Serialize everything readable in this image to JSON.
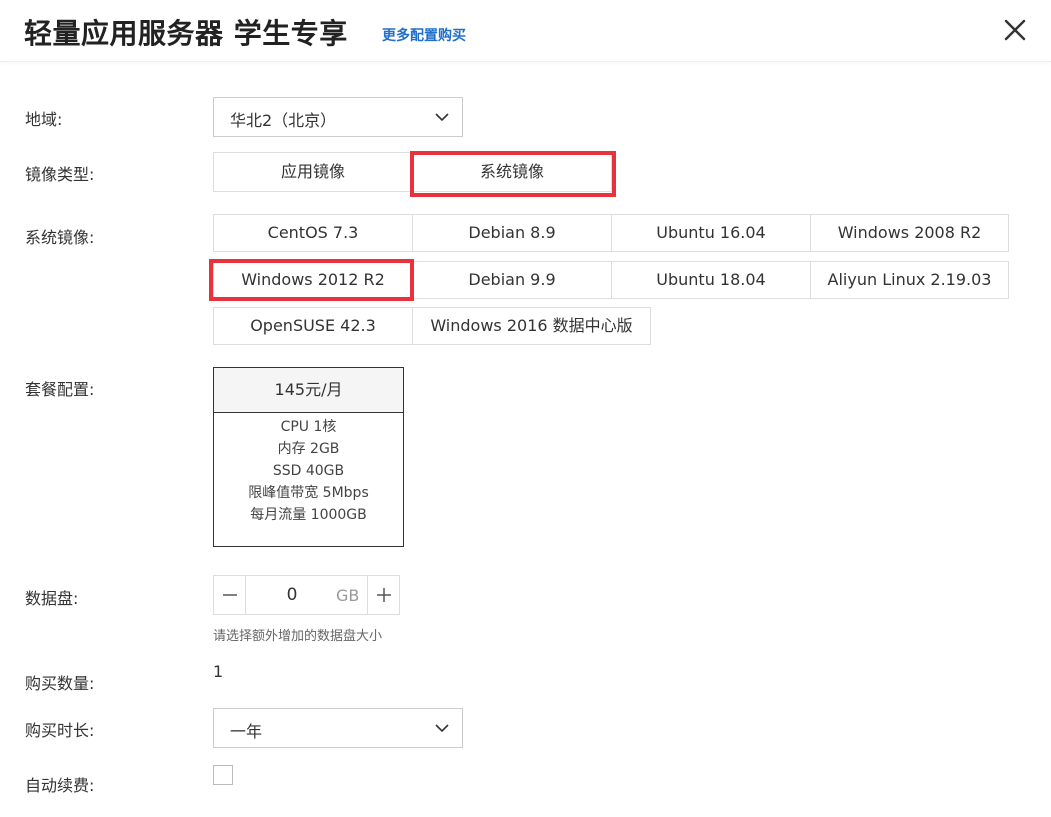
{
  "header": {
    "title": "轻量应用服务器 学生专享",
    "more_link": "更多配置购买",
    "close_icon": "close-icon"
  },
  "region": {
    "label": "地域:",
    "value": "华北2（北京）"
  },
  "image_type": {
    "label": "镜像类型:",
    "options": [
      "应用镜像",
      "系统镜像"
    ],
    "selected": "系统镜像"
  },
  "system_image": {
    "label": "系统镜像:",
    "options": [
      "CentOS 7.3",
      "Debian 8.9",
      "Ubuntu 16.04",
      "Windows 2008 R2",
      "Windows 2012 R2",
      "Debian 9.9",
      "Ubuntu 18.04",
      "Aliyun Linux 2.19.03",
      "OpenSUSE 42.3",
      "Windows 2016 数据中心版"
    ],
    "selected": "Windows 2012 R2"
  },
  "plan": {
    "label": "套餐配置:",
    "price": "145元/月",
    "specs": [
      "CPU 1核",
      "内存 2GB",
      "SSD 40GB",
      "限峰值带宽 5Mbps",
      "每月流量 1000GB"
    ]
  },
  "data_disk": {
    "label": "数据盘:",
    "value": "0",
    "unit": "GB",
    "hint": "请选择额外增加的数据盘大小"
  },
  "quantity": {
    "label": "购买数量:",
    "value": "1"
  },
  "duration": {
    "label": "购买时长:",
    "value": "一年"
  },
  "auto_renew": {
    "label": "自动续费:",
    "checked": false
  },
  "colors": {
    "highlight": "#e8323c",
    "link": "#1f6fcc"
  }
}
